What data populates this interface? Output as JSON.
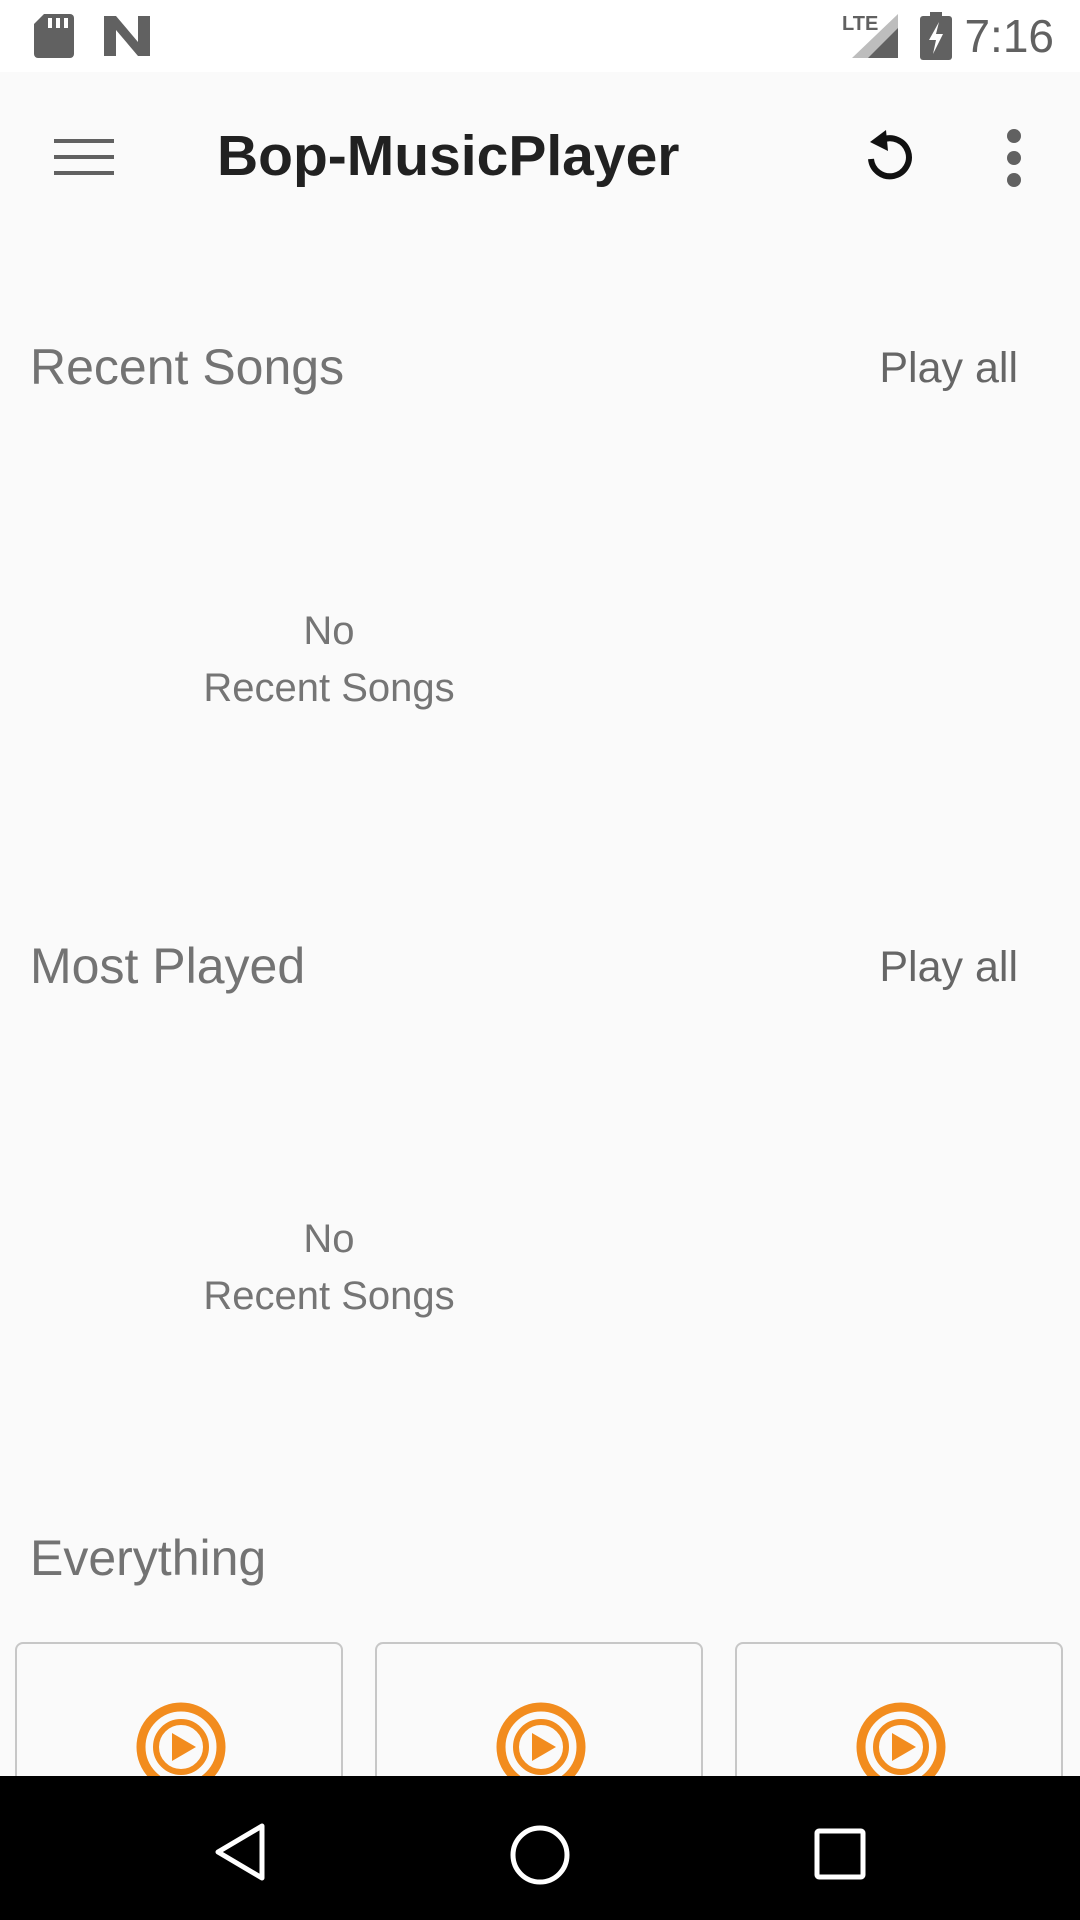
{
  "status_bar": {
    "time": "7:16",
    "network": "LTE",
    "icons": [
      "sd-card-icon",
      "n-logo-icon",
      "signal-icon",
      "battery-charging-icon"
    ]
  },
  "app_bar": {
    "title": "Bop-MusicPlayer",
    "icons": [
      "menu-icon",
      "refresh-icon",
      "overflow-menu-icon"
    ]
  },
  "sections": {
    "recent": {
      "title": "Recent Songs",
      "play_all": "Play all",
      "empty_line1": "No",
      "empty_line2": "Recent Songs"
    },
    "most_played": {
      "title": "Most Played",
      "play_all": "Play all",
      "empty_line1": "No",
      "empty_line2": "Recent Songs"
    },
    "everything": {
      "title": "Everything",
      "cards": [
        {
          "icon": "play-circle-icon"
        },
        {
          "icon": "play-circle-icon"
        },
        {
          "icon": "play-circle-icon"
        }
      ]
    }
  },
  "nav_bar": {
    "icons": [
      "back-icon",
      "home-icon",
      "recents-icon"
    ]
  },
  "colors": {
    "accent": "#f28c1e",
    "background": "#fafafa",
    "title_text": "#212121",
    "section_text": "#737373"
  }
}
